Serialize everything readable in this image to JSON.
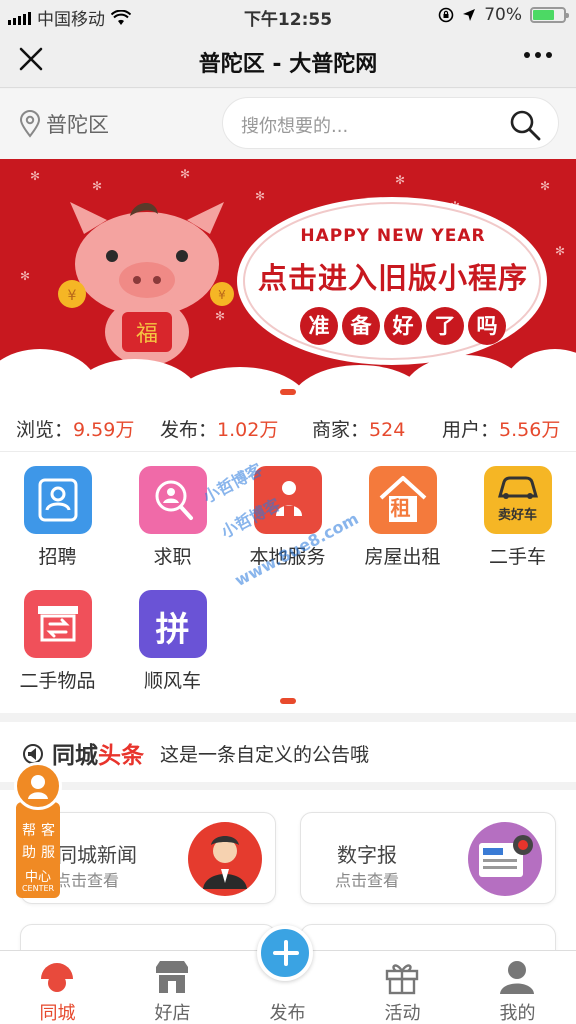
{
  "status_bar": {
    "carrier": "中国移动",
    "time": "下午12:55",
    "battery_text": "70%",
    "battery_level": 0.7,
    "battery_color": "#4cd964"
  },
  "nav": {
    "title": "普陀区 - 大普陀网",
    "close_icon": "close-icon",
    "more_icon": "more-icon"
  },
  "search": {
    "location": "普陀区",
    "placeholder": "搜你想要的..."
  },
  "banner": {
    "headline_en": "HAPPY NEW YEAR",
    "headline_cn": "点击进入旧版小程序",
    "sub_chars": [
      "准",
      "备",
      "好",
      "了",
      "吗"
    ],
    "pig_badge": "福",
    "accent": "#c8181f"
  },
  "stats": [
    {
      "label": "浏览：",
      "value": "9.59万"
    },
    {
      "label": "发布：",
      "value": "1.02万"
    },
    {
      "label": "商家：",
      "value": "524"
    },
    {
      "label": "用户：",
      "value": "5.56万"
    }
  ],
  "categories": [
    {
      "label": "招聘",
      "icon": "resume-icon",
      "color": "#3e97e8"
    },
    {
      "label": "求职",
      "icon": "search-person-icon",
      "color": "#f06aa8"
    },
    {
      "label": "本地服务",
      "icon": "worker-icon",
      "color": "#e84a3c"
    },
    {
      "label": "房屋出租",
      "icon": "house-rent-icon",
      "color": "#f47a3c",
      "badge": "租"
    },
    {
      "label": "二手车",
      "icon": "car-icon",
      "color": "#f5b625",
      "badge": "卖好车"
    },
    {
      "label": "二手物品",
      "icon": "exchange-box-icon",
      "color": "#f0505a"
    },
    {
      "label": "顺风车",
      "icon": "carpool-icon",
      "color": "#6a53d6",
      "badge": "拼"
    }
  ],
  "notice": {
    "brand_a": "同城",
    "brand_b": "头条",
    "text": "这是一条自定义的公告哦"
  },
  "cards": [
    {
      "title": "同城新闻",
      "subtitle": "点击查看"
    },
    {
      "title": "数字报",
      "subtitle": "点击查看"
    }
  ],
  "help": {
    "col1": [
      "帮",
      "助"
    ],
    "col2": [
      "客",
      "服"
    ],
    "label": "中心",
    "label_en": "CENTER"
  },
  "tabs": [
    {
      "label": "同城",
      "icon": "home-icon",
      "active": true
    },
    {
      "label": "好店",
      "icon": "store-icon"
    },
    {
      "label": "发布",
      "icon": "plus-icon"
    },
    {
      "label": "活动",
      "icon": "gift-icon"
    },
    {
      "label": "我的",
      "icon": "user-icon"
    }
  ],
  "watermark": [
    "小哲博客",
    "www.8ue8.com"
  ]
}
